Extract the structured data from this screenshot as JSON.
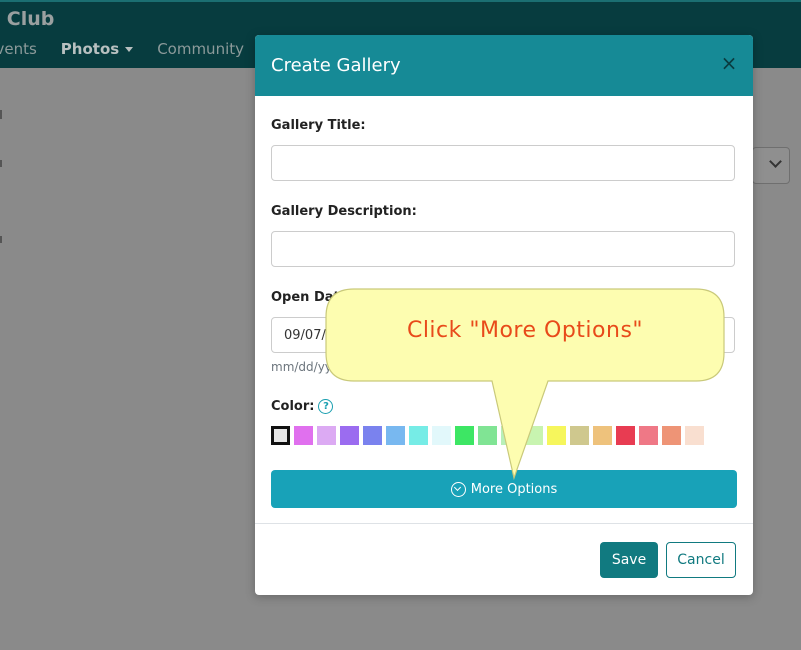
{
  "app": {
    "brand": "ra Club",
    "nav": [
      {
        "label": "Events"
      },
      {
        "label": "Photos",
        "has_dropdown": true
      },
      {
        "label": "Community"
      }
    ]
  },
  "modal": {
    "title": "Create Gallery",
    "close_icon": "close-icon",
    "fields": {
      "title_label": "Gallery Title:",
      "title_value": "",
      "description_label": "Gallery Description:",
      "description_value": "",
      "open_date_label": "Open Date",
      "open_date_value": "09/07/",
      "open_date_hint": "mm/dd/yy",
      "color_label": "Color:"
    },
    "colors": [
      "#e6e6e6",
      "#e070ee",
      "#dcaaf3",
      "#9b6cf0",
      "#7a82ee",
      "#78b8f0",
      "#76ece6",
      "#e2f8fb",
      "#3de664",
      "#80e494",
      "#b8f0b8",
      "#c8f4b0",
      "#f6f65c",
      "#cfc88e",
      "#eec27c",
      "#e83c52",
      "#ef7886",
      "#ee9476",
      "#f9dfd0"
    ],
    "selected_color_index": 0,
    "more_options_label": "More Options",
    "save_label": "Save",
    "cancel_label": "Cancel"
  },
  "callout": {
    "text": "Click \"More Options\""
  },
  "theme": {
    "header_bg": "#073c3f",
    "modal_header_bg": "#168a96",
    "primary_button": "#18a2b8",
    "save_button": "#117a80",
    "callout_fill": "#fdfdb0",
    "callout_text": "#e84a1a"
  }
}
